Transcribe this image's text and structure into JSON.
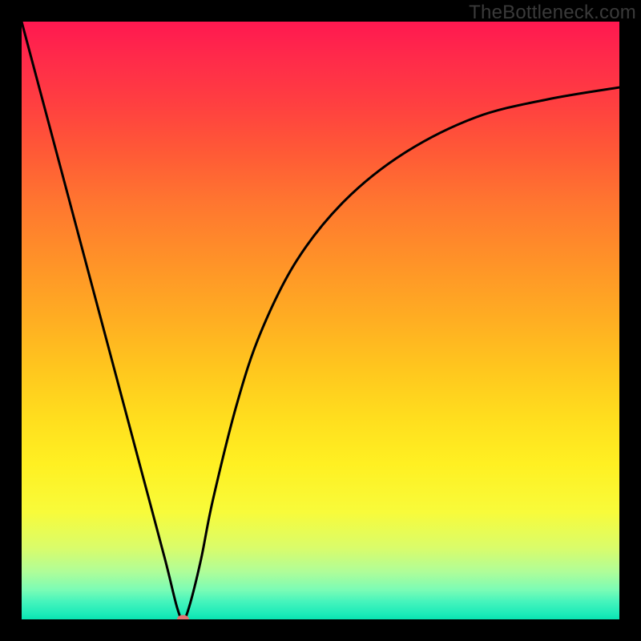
{
  "watermark": "TheBottleneck.com",
  "chart_data": {
    "type": "line",
    "title": "",
    "xlabel": "",
    "ylabel": "",
    "xlim": [
      0,
      100
    ],
    "ylim": [
      0,
      100
    ],
    "grid": false,
    "legend": false,
    "gradient_background": {
      "top": "#ff1850",
      "middle": "#ffc61e",
      "bottom": "#09e3b2"
    },
    "series": [
      {
        "name": "bottleneck-curve",
        "color": "#000000",
        "x": [
          0,
          4,
          8,
          12,
          16,
          20,
          24,
          26,
          27,
          28,
          30,
          32,
          36,
          40,
          46,
          54,
          64,
          76,
          88,
          100
        ],
        "y": [
          100,
          85,
          70,
          55,
          40,
          25,
          10,
          2,
          0,
          2,
          10,
          20,
          36,
          48,
          60,
          70,
          78,
          84,
          87,
          89
        ]
      }
    ],
    "marker": {
      "name": "minimum-point",
      "x": 27,
      "y": 0,
      "color": "#e57373"
    }
  }
}
